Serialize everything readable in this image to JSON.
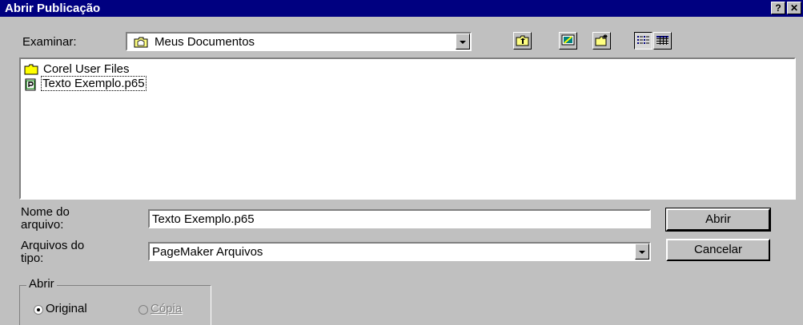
{
  "window": {
    "title": "Abrir Publicação",
    "help_glyph": "?",
    "close_glyph": "✕"
  },
  "look_in": {
    "label": "Examinar:",
    "value": "Meus Documentos",
    "icon": "my-documents-folder-icon"
  },
  "toolbar": {
    "buttons": [
      {
        "name": "up-one-level",
        "icon": "folder-up-icon"
      },
      {
        "name": "desktop",
        "icon": "desktop-icon"
      },
      {
        "name": "create-new-folder",
        "icon": "new-folder-icon"
      },
      {
        "name": "list-view",
        "icon": "list-view-icon",
        "pressed": true
      },
      {
        "name": "details-view",
        "icon": "details-view-icon"
      }
    ]
  },
  "files": [
    {
      "name": "Corel User Files",
      "type": "folder",
      "icon": "folder-icon"
    },
    {
      "name": "Texto Exemplo.p65",
      "type": "file",
      "icon": "pagemaker-file-icon",
      "selected": true
    }
  ],
  "filename": {
    "label_line1": "Nome do",
    "label_line2": "arquivo:",
    "value": "Texto Exemplo.p65"
  },
  "filetype": {
    "label_line1": "Arquivos do",
    "label_line2": "tipo:",
    "value": "PageMaker Arquivos"
  },
  "buttons": {
    "open": "Abrir",
    "cancel": "Cancelar"
  },
  "open_group": {
    "legend": "Abrir",
    "options": [
      {
        "label": "Original",
        "selected": true,
        "enabled": true
      },
      {
        "label": "Cópia",
        "selected": false,
        "enabled": false
      }
    ]
  },
  "colors": {
    "titlebar": "#000080",
    "face": "#c0c0c0",
    "folder": "#ffff00"
  }
}
